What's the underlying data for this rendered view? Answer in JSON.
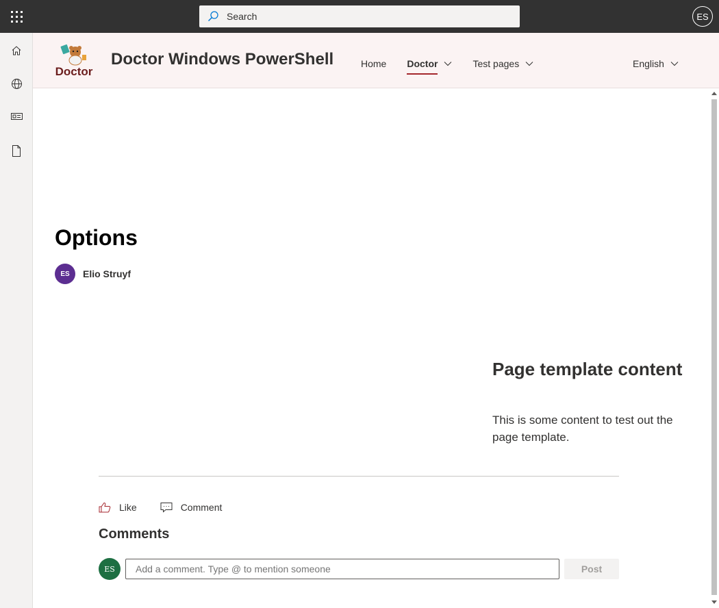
{
  "suitebar": {
    "search_placeholder": "Search",
    "user_initials": "ES",
    "background": "#323232"
  },
  "appbar": {
    "items": [
      {
        "icon": "home-icon"
      },
      {
        "icon": "globe-icon"
      },
      {
        "icon": "news-icon"
      },
      {
        "icon": "document-icon"
      }
    ]
  },
  "site": {
    "logo_text": "Doctor",
    "title": "Doctor Windows PowerShell",
    "nav": [
      {
        "label": "Home",
        "selected": false,
        "dropdown": false
      },
      {
        "label": "Doctor",
        "selected": true,
        "dropdown": true
      },
      {
        "label": "Test pages",
        "selected": false,
        "dropdown": true
      }
    ],
    "language": "English",
    "accent": "#a4262c"
  },
  "page": {
    "title": "Options",
    "author_initials": "ES",
    "author_name": "Elio Struyf",
    "template_heading": "Page template content",
    "template_text": "This is some content to test out the page template."
  },
  "social": {
    "like_label": "Like",
    "comment_label": "Comment",
    "comments_heading": "Comments",
    "commenter_initials": "ES",
    "comment_placeholder": "Add a comment. Type @ to mention someone",
    "post_label": "Post"
  }
}
